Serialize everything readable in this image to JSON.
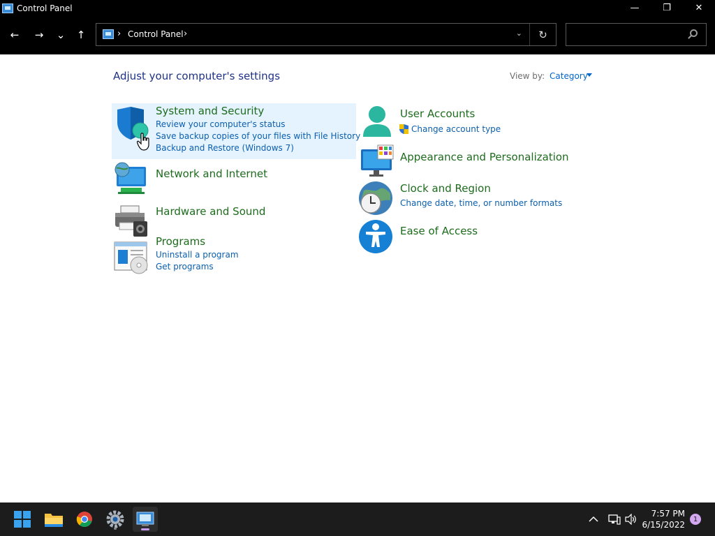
{
  "window": {
    "title": "Control Panel",
    "minimize": "—",
    "restore": "❐",
    "close": "✕"
  },
  "nav": {
    "back": "←",
    "forward": "→",
    "recent": "⌄",
    "up": "↑",
    "path": "Control Panel",
    "search_placeholder": ""
  },
  "content": {
    "title": "Adjust your computer's settings",
    "view_by_label": "View by:",
    "view_by_value": "Category"
  },
  "categories_left": [
    {
      "title": "System and Security",
      "links": [
        "Review your computer's status",
        "Save backup copies of your files with File History",
        "Backup and Restore (Windows 7)"
      ]
    },
    {
      "title": "Network and Internet",
      "links": []
    },
    {
      "title": "Hardware and Sound",
      "links": []
    },
    {
      "title": "Programs",
      "links": [
        "Uninstall a program",
        "Get programs"
      ]
    }
  ],
  "categories_right": [
    {
      "title": "User Accounts",
      "links": [
        "Change account type"
      ]
    },
    {
      "title": "Appearance and Personalization",
      "links": []
    },
    {
      "title": "Clock and Region",
      "links": [
        "Change date, time, or number formats"
      ]
    },
    {
      "title": "Ease of Access",
      "links": []
    }
  ],
  "taskbar": {
    "time": "7:57 PM",
    "date": "6/15/2022",
    "notifications": "1",
    "apps": [
      "start-icon",
      "file-explorer-icon",
      "chrome-icon",
      "settings-icon",
      "control-panel-icon"
    ]
  },
  "colors": {
    "category_title": "#1d6c1d",
    "link": "#0b5fae",
    "heading": "#1e3287",
    "hover": "#e5f3ff"
  }
}
